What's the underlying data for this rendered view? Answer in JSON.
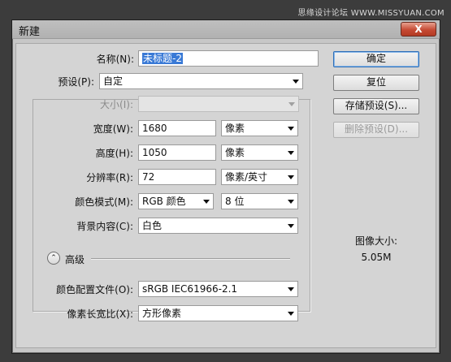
{
  "watermark": "思缘设计论坛 WWW.MISSYUAN.COM",
  "dialog": {
    "title": "新建",
    "close": "X"
  },
  "fields": {
    "name_label": "名称(N):",
    "name_value": "未标题-2",
    "preset_label": "预设(P):",
    "preset_value": "自定",
    "size_label": "大小(I):",
    "size_value": "",
    "width_label": "宽度(W):",
    "width_value": "1680",
    "width_unit": "像素",
    "height_label": "高度(H):",
    "height_value": "1050",
    "height_unit": "像素",
    "resolution_label": "分辨率(R):",
    "resolution_value": "72",
    "resolution_unit": "像素/英寸",
    "colormode_label": "颜色模式(M):",
    "colormode_value": "RGB 颜色",
    "bitdepth_value": "8 位",
    "background_label": "背景内容(C):",
    "background_value": "白色",
    "advanced_label": "高级",
    "advanced_icon": "chevron-up-double-icon",
    "profile_label": "颜色配置文件(O):",
    "profile_value": "sRGB IEC61966-2.1",
    "aspect_label": "像素长宽比(X):",
    "aspect_value": "方形像素"
  },
  "buttons": {
    "ok": "确定",
    "reset": "复位",
    "save_preset": "存储预设(S)...",
    "delete_preset": "删除预设(D)..."
  },
  "info": {
    "image_size_label": "图像大小:",
    "image_size_value": "5.05M"
  }
}
